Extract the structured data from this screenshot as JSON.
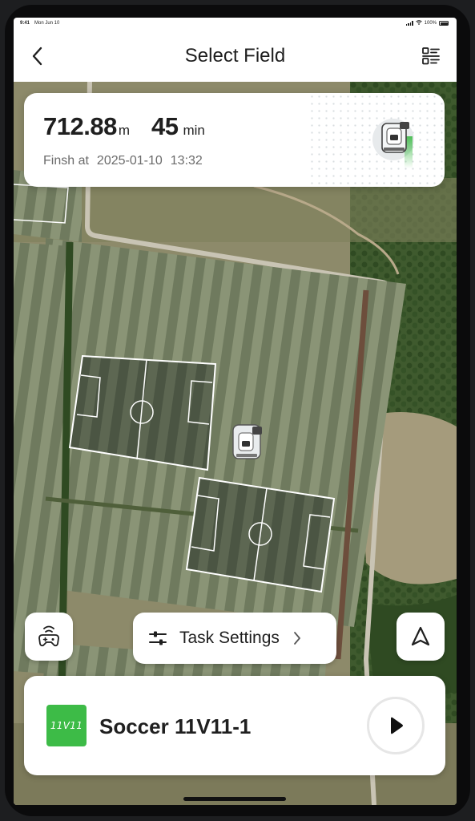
{
  "status_bar": {
    "time": "9:41",
    "date": "Mon Jun 10",
    "battery": "100%"
  },
  "header": {
    "title": "Select Field",
    "back_icon": "chevron-left-icon",
    "list_icon": "list-icon"
  },
  "stats": {
    "distance_value": "712.88",
    "distance_unit": "m",
    "duration_value": "45",
    "duration_unit": "min",
    "finish_label": "Finsh at",
    "finish_date": "2025-01-10",
    "finish_time": "13:32",
    "robot_icon": "mower-robot-icon"
  },
  "controls": {
    "remote_icon": "gamepad-icon",
    "task_settings_label": "Task Settings",
    "task_settings_icon": "sliders-icon",
    "navigation_icon": "navigation-arrow-icon"
  },
  "field": {
    "badge": "11V11",
    "name": "Soccer 11V11-1",
    "play_icon": "play-icon"
  },
  "colors": {
    "accent_green": "#3dbb47",
    "text_primary": "#1f1f1f",
    "text_secondary": "#6b6b6b"
  }
}
